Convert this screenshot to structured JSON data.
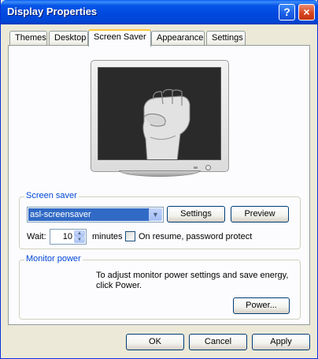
{
  "window": {
    "title": "Display Properties",
    "help": "?",
    "close": "×"
  },
  "tabs": [
    {
      "label": "Themes"
    },
    {
      "label": "Desktop"
    },
    {
      "label": "Screen Saver"
    },
    {
      "label": "Appearance"
    },
    {
      "label": "Settings"
    }
  ],
  "screensaver": {
    "group_label": "Screen saver",
    "selected": "asl-screensaver",
    "settings_label": "Settings",
    "preview_label": "Preview",
    "wait_label": "Wait:",
    "wait_value": "10",
    "minutes_label": "minutes",
    "resume_label": "On resume, password protect"
  },
  "power": {
    "group_label": "Monitor power",
    "description": "To adjust monitor power settings and save energy, click Power.",
    "button_label": "Power..."
  },
  "footer": {
    "ok": "OK",
    "cancel": "Cancel",
    "apply": "Apply"
  }
}
